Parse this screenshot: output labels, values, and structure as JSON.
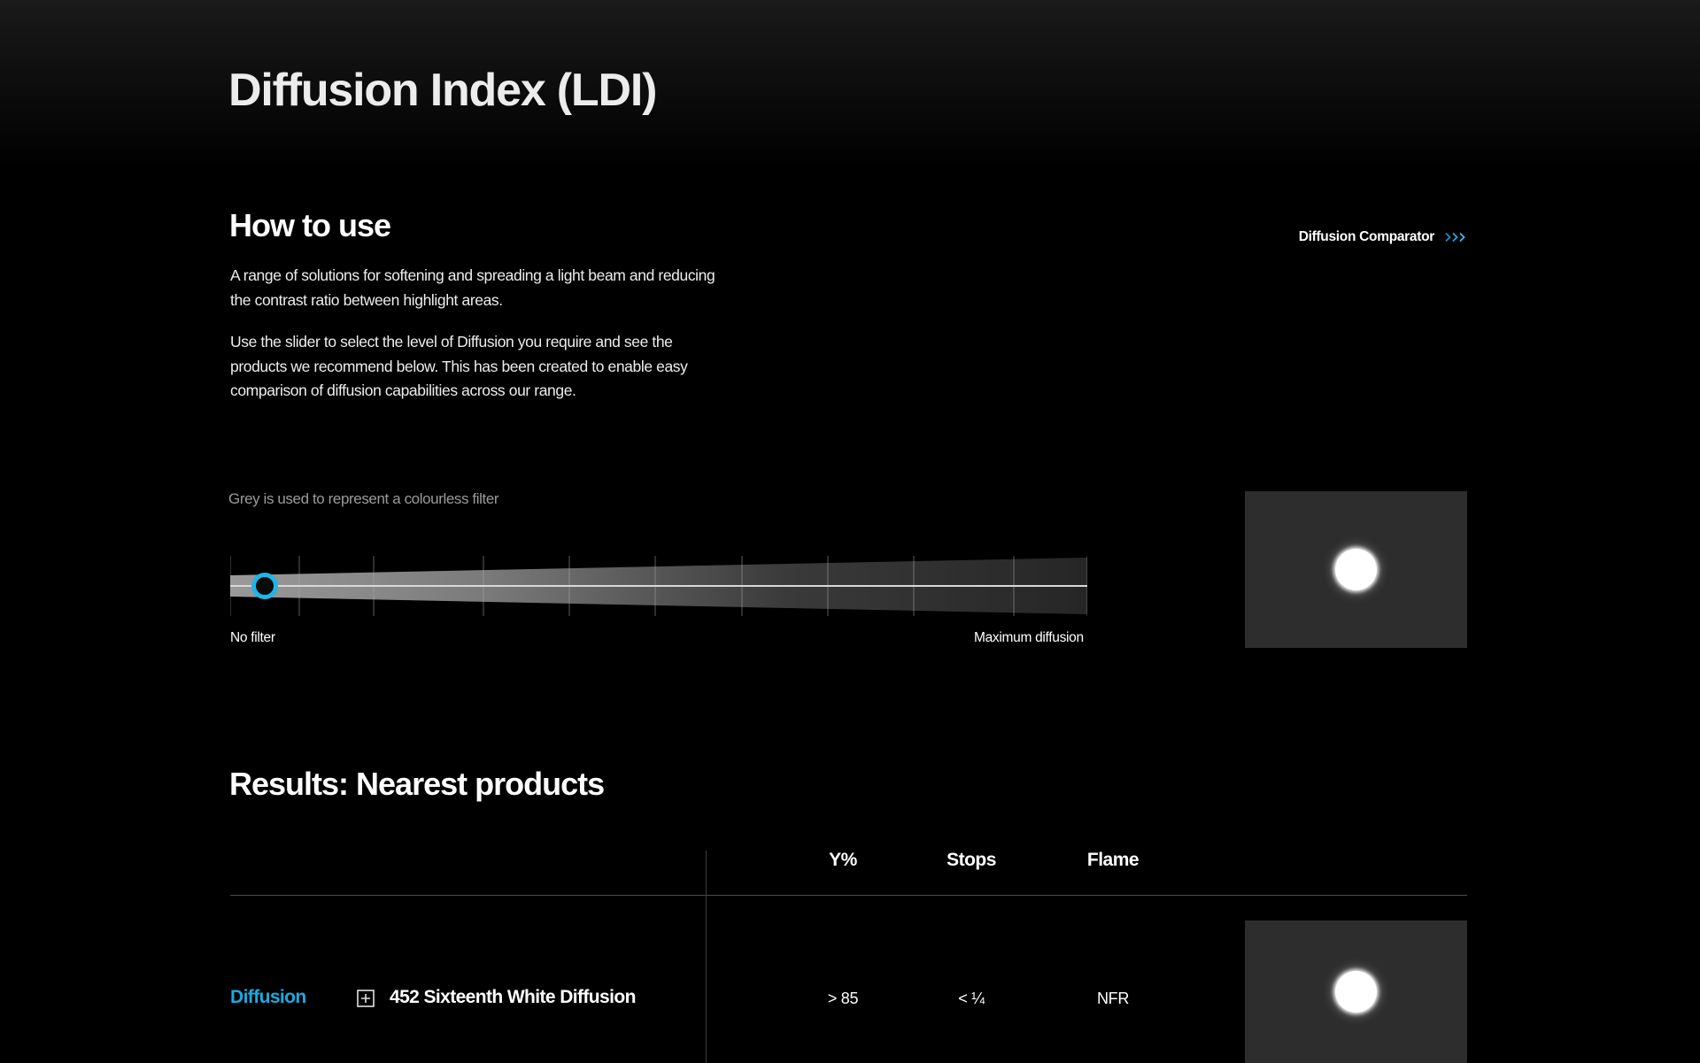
{
  "header": {
    "title": "Diffusion Index (LDI)"
  },
  "how_to_use": {
    "title": "How to use",
    "paragraph_1": "A range of solutions for softening and spreading a light beam and reducing the contrast ratio between highlight areas.",
    "paragraph_2": "Use the slider to select the level of Diffusion you require and see the products we recommend below. This has been created to enable easy comparison of diffusion capabilities across our range."
  },
  "comparator_link": {
    "label": "Diffusion Comparator",
    "icon": "double-chevron-right-icon"
  },
  "slider": {
    "note": "Grey is used to represent a colourless filter",
    "min_label": "No filter",
    "max_label": "Maximum diffusion",
    "value_fraction": 0.04,
    "accent_color": "#1fb5e6"
  },
  "results": {
    "title": "Results: Nearest products",
    "columns": {
      "y": "Y%",
      "stops": "Stops",
      "flame": "Flame"
    },
    "rows": [
      {
        "category": "Diffusion",
        "name": "452 Sixteenth White Diffusion",
        "y": "> 85",
        "stops": "< ¼",
        "flame": "NFR"
      }
    ]
  },
  "colors": {
    "accent": "#1fa9df",
    "preview_bg": "#2d2d2d"
  }
}
